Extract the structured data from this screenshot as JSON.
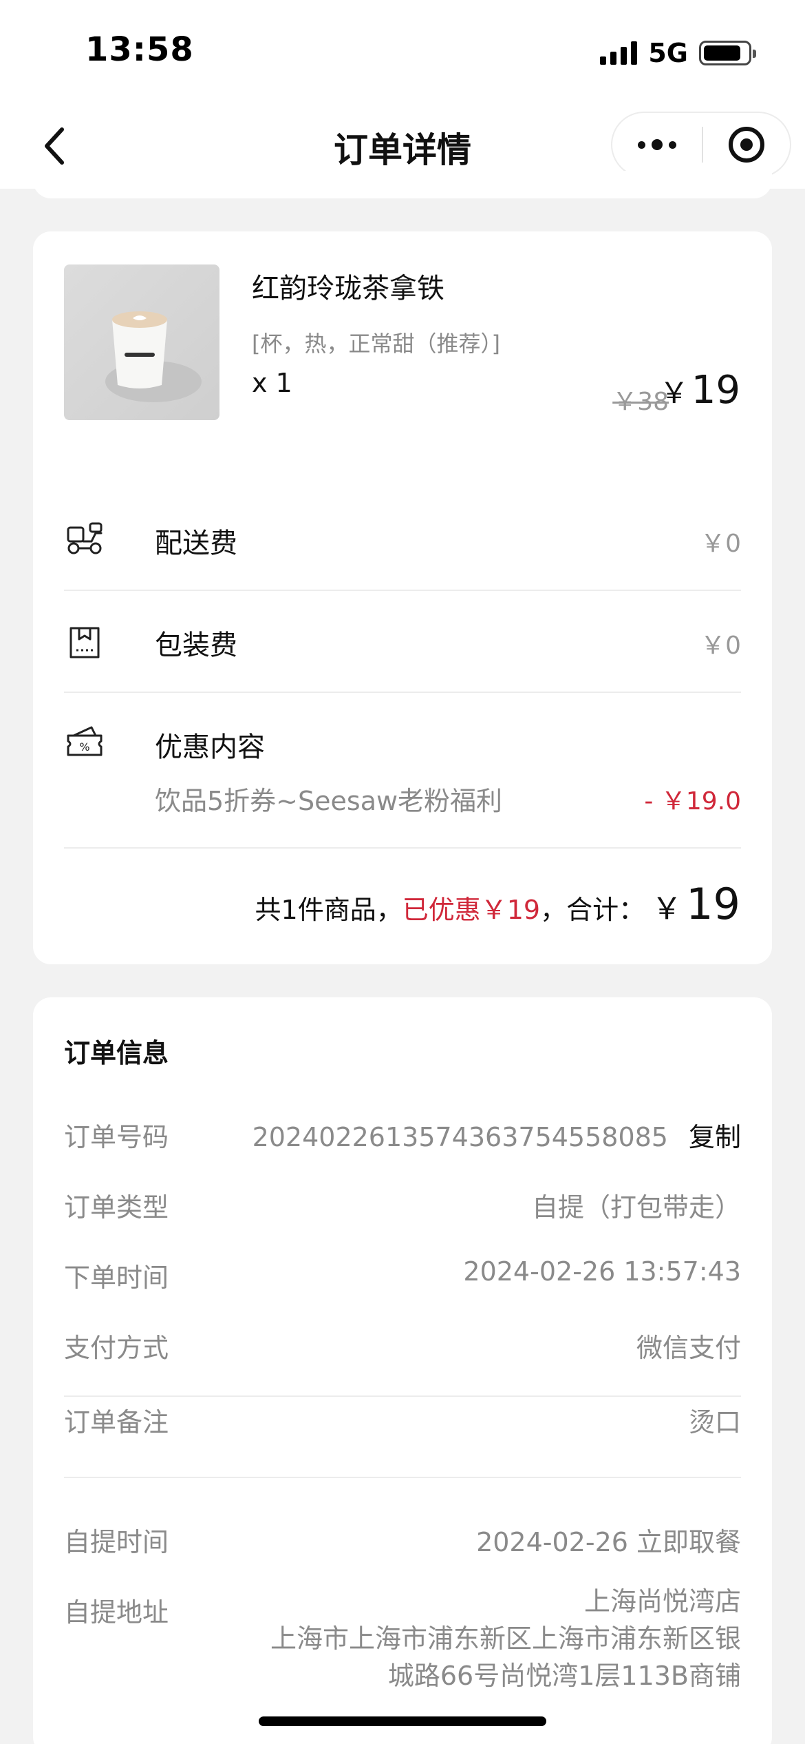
{
  "status_bar": {
    "time": "13:58",
    "network": "5G",
    "battery_level": 0.85
  },
  "nav": {
    "title": "订单详情",
    "back_icon": "chevron-left-icon",
    "more_icon": "more-dots-icon",
    "close_icon": "target-circle-icon"
  },
  "product": {
    "name": "红韵玲珑茶拿铁",
    "spec": "[杯，热，正常甜（推荐）]",
    "quantity": "x 1",
    "original_price": "￥38",
    "currency": "￥",
    "price": "19",
    "image_icon": "coffee-cup-image"
  },
  "fees": [
    {
      "icon": "delivery-scooter-icon",
      "label": "配送费",
      "value": "￥0"
    },
    {
      "icon": "package-bag-icon",
      "label": "包装费",
      "value": "￥0"
    }
  ],
  "discount": {
    "icon": "coupon-percent-icon",
    "label": "优惠内容",
    "description": "饮品5折券~Seesaw老粉福利",
    "amount": "- ￥19.0"
  },
  "summary": {
    "count_text": "共1件商品，",
    "saved_text": "已优惠￥19",
    "total_label": "，合计：",
    "currency": "￥",
    "total": "19"
  },
  "order_info": {
    "title": "订单信息",
    "order_number_label": "订单号码",
    "order_number": "20240226135743637545580­85",
    "copy_label": "复制",
    "order_type_label": "订单类型",
    "order_type": "自提（打包带走）",
    "order_time_label": "下单时间",
    "order_time": "2024-02-26 13:57:43",
    "payment_label": "支付方式",
    "payment": "微信支付",
    "remark_label": "订单备注",
    "remark": "烫口",
    "pickup_time_label": "自提时间",
    "pickup_time": "2024-02-26 立即取餐",
    "pickup_address_label": "自提地址",
    "store_name": "上海尚悦湾店",
    "address_line1": "上海市上海市浦东新区上海市浦东新区银",
    "address_line2": "城路66号尚悦湾1层113B商铺"
  },
  "colors": {
    "accent_red": "#d0283a",
    "muted_text": "#8a8a8a",
    "background": "#f2f2f2"
  }
}
